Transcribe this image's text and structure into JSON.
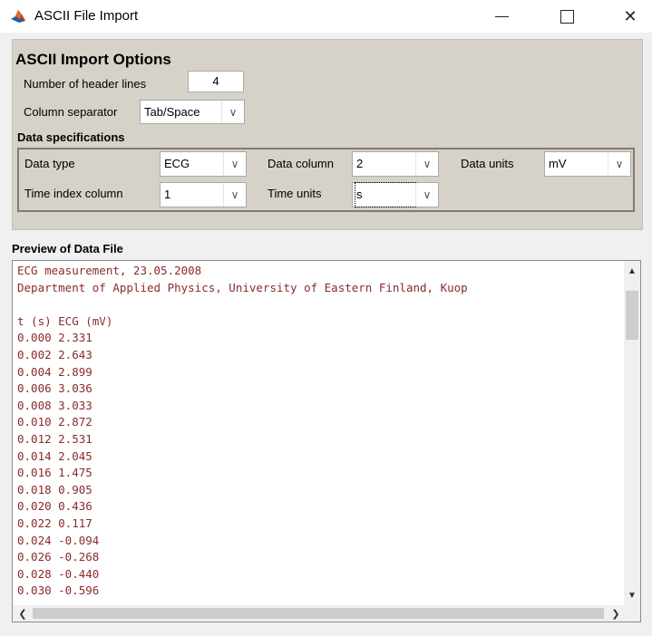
{
  "window": {
    "title": "ASCII File Import",
    "icon": "matlab-icon",
    "minimize_icon": "minimize-icon",
    "maximize_icon": "maximize-icon",
    "close_icon": "close-icon",
    "close_glyph": "✕"
  },
  "options": {
    "title": "ASCII Import Options",
    "header_lines_label": "Number of header lines",
    "header_lines_value": "4",
    "separator_label": "Column separator",
    "separator_value": "Tab/Space",
    "data_spec_title": "Data specifications",
    "data_type_label": "Data type",
    "data_type_value": "ECG",
    "data_column_label": "Data column",
    "data_column_value": "2",
    "data_units_label": "Data units",
    "data_units_value": "mV",
    "time_index_label": "Time index column",
    "time_index_value": "1",
    "time_units_label": "Time units",
    "time_units_value": "s"
  },
  "preview": {
    "title": "Preview of Data File",
    "lines": [
      "ECG measurement, 23.05.2008",
      "Department of Applied Physics, University of Eastern Finland, Kuop",
      "",
      "t (s) ECG (mV)",
      "0.000 2.331",
      "0.002 2.643",
      "0.004 2.899",
      "0.006 3.036",
      "0.008 3.033",
      "0.010 2.872",
      "0.012 2.531",
      "0.014 2.045",
      "0.016 1.475",
      "0.018 0.905",
      "0.020 0.436",
      "0.022 0.117",
      "0.024 -0.094",
      "0.026 -0.268",
      "0.028 -0.440",
      "0.030 -0.596"
    ]
  },
  "colors": {
    "panel_bg": "#d6d2ca",
    "preview_text": "#8a2b2b"
  }
}
